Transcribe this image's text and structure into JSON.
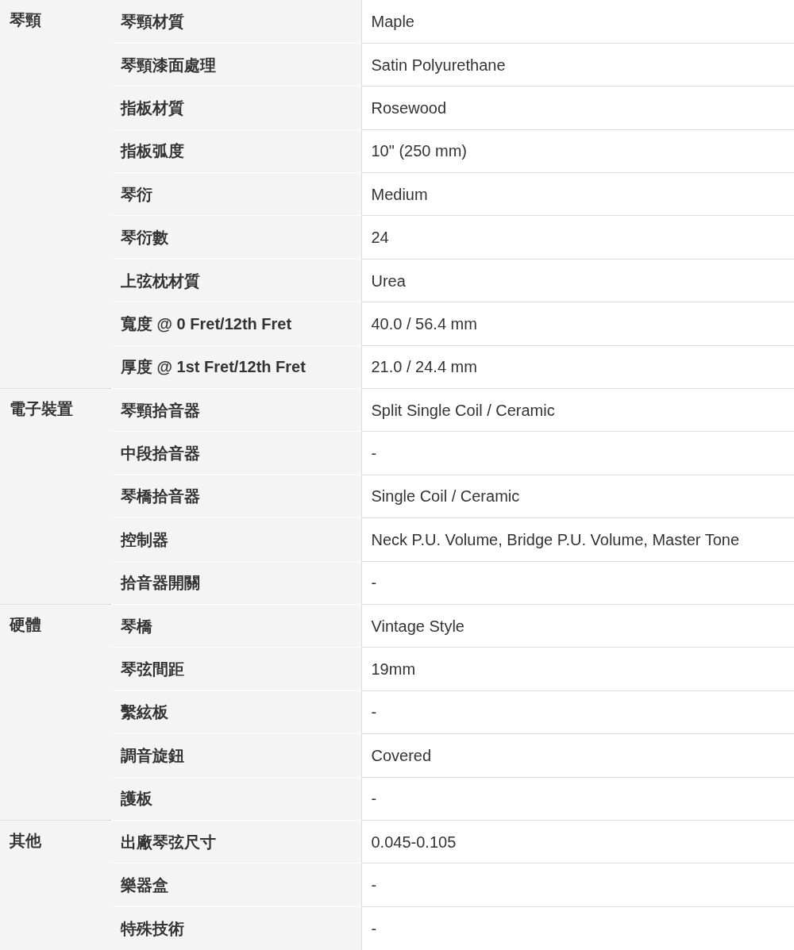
{
  "groups": [
    {
      "name": "琴頸",
      "rows": [
        {
          "label": "琴頸材質",
          "value": "Maple"
        },
        {
          "label": "琴頸漆面處理",
          "value": "Satin Polyurethane"
        },
        {
          "label": "指板材質",
          "value": "Rosewood"
        },
        {
          "label": "指板弧度",
          "value": "10\" (250 mm)"
        },
        {
          "label": "琴衍",
          "value": "Medium"
        },
        {
          "label": "琴衍數",
          "value": "24"
        },
        {
          "label": "上弦枕材質",
          "value": "Urea"
        },
        {
          "label": "寬度 @ 0 Fret/12th Fret",
          "value": "40.0 / 56.4 mm"
        },
        {
          "label": "厚度 @ 1st Fret/12th Fret",
          "value": "21.0 / 24.4 mm"
        }
      ]
    },
    {
      "name": "電子裝置",
      "rows": [
        {
          "label": "琴頸拾音器",
          "value": "Split Single Coil / Ceramic"
        },
        {
          "label": "中段拾音器",
          "value": "-"
        },
        {
          "label": "琴橋拾音器",
          "value": "Single Coil / Ceramic"
        },
        {
          "label": "控制器",
          "value": "Neck P.U. Volume, Bridge P.U. Volume, Master Tone"
        },
        {
          "label": "拾音器開關",
          "value": "-"
        }
      ]
    },
    {
      "name": "硬體",
      "rows": [
        {
          "label": "琴橋",
          "value": "Vintage Style"
        },
        {
          "label": "琴弦間距",
          "value": "19mm"
        },
        {
          "label": "繫絃板",
          "value": "-"
        },
        {
          "label": "調音旋鈕",
          "value": "Covered"
        },
        {
          "label": "護板",
          "value": "-"
        }
      ]
    },
    {
      "name": "其他",
      "rows": [
        {
          "label": "出廠琴弦尺寸",
          "value": "0.045-0.105"
        },
        {
          "label": "樂器盒",
          "value": "-"
        },
        {
          "label": "特殊技術",
          "value": "-"
        }
      ]
    }
  ]
}
